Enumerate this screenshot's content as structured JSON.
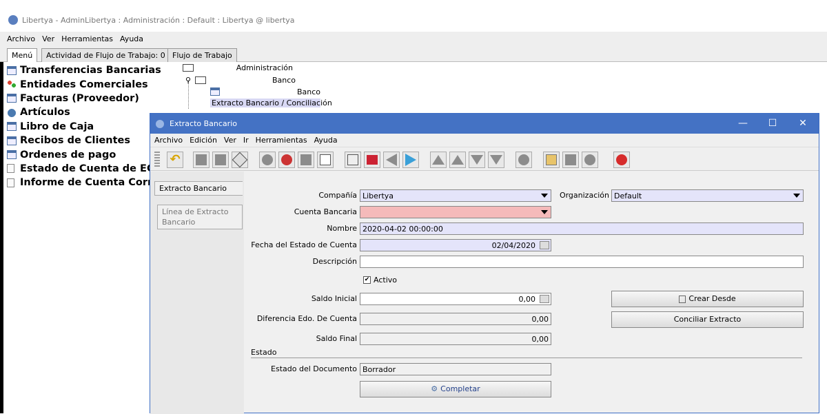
{
  "app": {
    "title": "Libertya  -  AdminLibertya : Administración : Default : Libertya @ libertya",
    "menu": [
      "Archivo",
      "Ver",
      "Herramientas",
      "Ayuda"
    ],
    "tabs": [
      "Menú",
      "Actividad de Flujo de Trabajo: 0",
      "Flujo de Trabajo"
    ]
  },
  "menu_list": [
    {
      "label": "Transferencias Bancarias",
      "icon": "window-icon"
    },
    {
      "label": "Entidades Comerciales",
      "icon": "people-icon"
    },
    {
      "label": "Facturas (Proveedor)",
      "icon": "window-icon"
    },
    {
      "label": "Artículos",
      "icon": "product-icon"
    },
    {
      "label": "Libro de Caja",
      "icon": "window-icon"
    },
    {
      "label": "Recibos de Clientes",
      "icon": "window-icon"
    },
    {
      "label": "Ordenes de pago",
      "icon": "window-icon"
    },
    {
      "label": "Estado de Cuenta de EC",
      "icon": "document-icon"
    },
    {
      "label": "Informe de Cuenta Corriente",
      "icon": "document-icon"
    }
  ],
  "tree": {
    "root": "Administración",
    "folder": "Banco",
    "items": [
      "Banco",
      "Extracto Bancario / Conciliación"
    ]
  },
  "dialog": {
    "title": "Extracto Bancario",
    "menu": [
      "Archivo",
      "Edición",
      "Ver",
      "Ir",
      "Herramientas",
      "Ayuda"
    ],
    "side_tabs": [
      "Extracto Bancario",
      "Línea de Extracto Bancario"
    ],
    "form": {
      "compania_label": "Compañía",
      "compania_value": "Libertya",
      "organizacion_label": "Organización",
      "organizacion_value": "Default",
      "cuenta_label": "Cuenta Bancaria",
      "cuenta_value": "",
      "nombre_label": "Nombre",
      "nombre_value": "2020-04-02 00:00:00",
      "fecha_label": "Fecha del Estado de Cuenta",
      "fecha_value": "02/04/2020",
      "descripcion_label": "Descripción",
      "descripcion_value": "",
      "activo_label": "Activo",
      "activo_checked": true,
      "saldo_inicial_label": "Saldo Inicial",
      "saldo_inicial_value": "0,00",
      "diferencia_label": "Diferencia Edo. De Cuenta",
      "diferencia_value": "0,00",
      "saldo_final_label": "Saldo Final",
      "saldo_final_value": "0,00",
      "estado_section": "Estado",
      "estado_doc_label": "Estado del Documento",
      "estado_doc_value": "Borrador",
      "crear_desde_label": "Crear Desde",
      "conciliar_label": "Conciliar Extracto",
      "completar_label": "Completar"
    }
  },
  "colors": {
    "dialog_title_bg": "#4472c4",
    "mandatory_field": "#e4e4fa",
    "error_field": "#f5baba",
    "close_icon": "#d62b2b"
  }
}
